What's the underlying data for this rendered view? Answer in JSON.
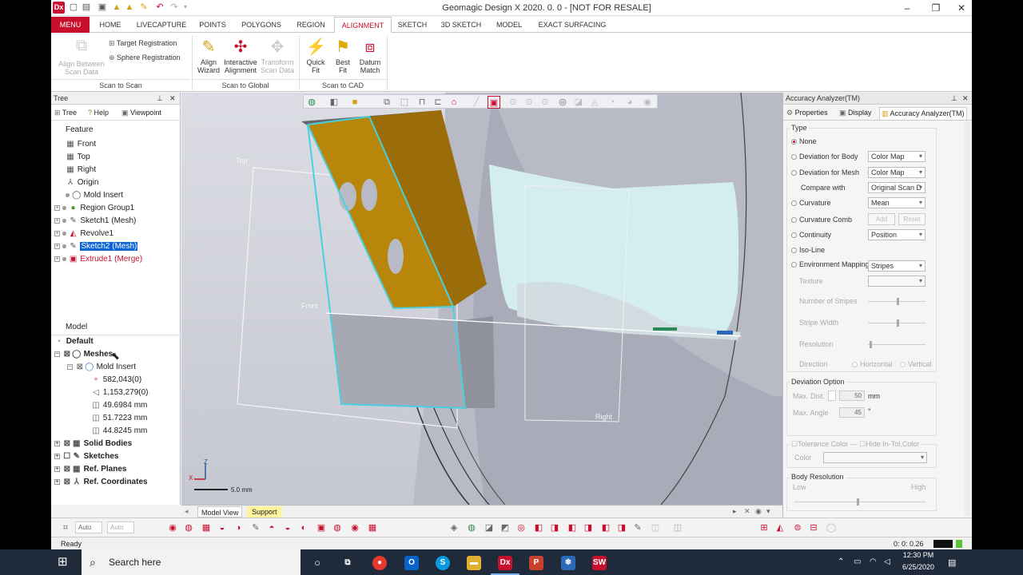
{
  "app": {
    "logo": "Dx",
    "title": "Geomagic Design X 2020. 0. 0 - [NOT FOR RESALE]",
    "window_controls": [
      "–",
      "❐",
      "✕"
    ]
  },
  "menu_tabs": [
    {
      "label": "MENU"
    },
    {
      "label": "HOME"
    },
    {
      "label": "LIVECAPTURE"
    },
    {
      "label": "POINTS"
    },
    {
      "label": "POLYGONS"
    },
    {
      "label": "REGION"
    },
    {
      "label": "ALIGNMENT"
    },
    {
      "label": "SKETCH"
    },
    {
      "label": "3D SKETCH"
    },
    {
      "label": "MODEL"
    },
    {
      "label": "EXACT SURFACING"
    }
  ],
  "ribbon": {
    "scan_to_scan": {
      "label": "Scan to Scan",
      "align_between_line1": "Align Between",
      "align_between_line2": "Scan Data",
      "target_registration": "Target Registration",
      "sphere_registration": "Sphere Registration"
    },
    "scan_to_global": {
      "label": "Scan to Global",
      "align_wizard_1": "Align",
      "align_wizard_2": "Wizard",
      "interactive_1": "Interactive",
      "interactive_2": "Alignment",
      "transform_1": "Transform",
      "transform_2": "Scan Data"
    },
    "scan_to_cad": {
      "label": "Scan to CAD",
      "quick_fit_1": "Quick",
      "quick_fit_2": "Fit",
      "best_fit_1": "Best",
      "best_fit_2": "Fit",
      "datum_match_1": "Datum",
      "datum_match_2": "Match"
    }
  },
  "tree_panel": {
    "title": "Tree",
    "tabs": [
      "Tree",
      "Help",
      "Viewpoint"
    ],
    "feature_header": "Feature",
    "features": [
      {
        "label": "Front",
        "icon": "plane-icon"
      },
      {
        "label": "Top",
        "icon": "plane-icon"
      },
      {
        "label": "Right",
        "icon": "plane-icon"
      },
      {
        "label": "Origin",
        "icon": "origin-icon"
      },
      {
        "label": "Mold Insert",
        "icon": "mesh-icon"
      },
      {
        "label": "Region Group1",
        "icon": "region-icon"
      },
      {
        "label": "Sketch1 (Mesh)",
        "icon": "sketch-icon"
      },
      {
        "label": "Revolve1",
        "icon": "revolve-icon"
      },
      {
        "label": "Sketch2 (Mesh)",
        "icon": "sketch-icon"
      },
      {
        "label": "Extrude1 (Merge)",
        "icon": "extrude-icon"
      }
    ],
    "model_header": "Model",
    "model_items": [
      {
        "label": "Default"
      },
      {
        "label": "Meshes"
      },
      {
        "label": "Mold Insert"
      },
      {
        "label": "582,043(0)"
      },
      {
        "label": "1,153,279(0)"
      },
      {
        "label": "49.6984 mm"
      },
      {
        "label": "51.7223 mm"
      },
      {
        "label": "44.8245 mm"
      },
      {
        "label": "Solid Bodies"
      },
      {
        "label": "Sketches"
      },
      {
        "label": "Ref. Planes"
      },
      {
        "label": "Ref. Coordinates"
      }
    ]
  },
  "viewport": {
    "label_top": "Top",
    "label_front": "Front",
    "label_right": "Right",
    "scale_label": "5.0 mm",
    "axis_z": "Z",
    "axis_x": "X"
  },
  "bottom_tabs": [
    "Model View",
    "Support"
  ],
  "right_panel": {
    "title": "Accuracy Analyzer(TM)",
    "tabs": [
      "Properties",
      "Display",
      "Accuracy Analyzer(TM)"
    ],
    "type_label": "Type",
    "type_options": [
      {
        "label": "None",
        "selected": true
      },
      {
        "label": "Deviation for Body"
      },
      {
        "label": "Deviation for Mesh"
      },
      {
        "label": "Compare with"
      },
      {
        "label": "Curvature"
      },
      {
        "label": "Curvature Comb"
      },
      {
        "label": "Continuity"
      },
      {
        "label": "Iso-Line"
      },
      {
        "label": "Environment Mapping"
      }
    ],
    "dropdowns": {
      "deviation_body": "Color Map",
      "deviation_mesh": "Color Map",
      "compare_with": "Original Scan D",
      "curvature": "Mean",
      "continuity": "Position",
      "environment": "Stripes"
    },
    "curvature_comb_add": "Add",
    "curvature_comb_reset": "Reset",
    "texture_label": "Texture",
    "number_of_stripes": "Number of Stripes",
    "stripe_width": "Stripe Width",
    "resolution": "Resolution",
    "direction": "Direction",
    "direction_horizontal": "Horizontal",
    "direction_vertical": "Vertical",
    "deviation_option": "Deviation Option",
    "max_dist_label": "Max. Dist.",
    "max_dist_value": "50",
    "max_dist_unit": "mm",
    "max_angle_label": "Max. Angle",
    "max_angle_value": "45",
    "max_angle_unit": "°",
    "tolerance_color": "Tolerance Color",
    "hide_in_tol_color": "Hide In-Tol.Color",
    "color_label": "Color",
    "body_resolution": "Body Resolution",
    "low": "Low",
    "high": "High"
  },
  "bottom_toolbar": {
    "auto1": "Auto",
    "auto2": "Auto"
  },
  "status": {
    "ready": "Ready",
    "time": "0: 0: 0.26"
  },
  "taskbar": {
    "search_placeholder": "Search here",
    "clock_time": "12:30 PM",
    "clock_date": "6/25/2020"
  },
  "colors": {
    "brand_red": "#c8102e",
    "selection_blue": "#0a64d6",
    "mesh_highlight": "#48d0e0"
  }
}
